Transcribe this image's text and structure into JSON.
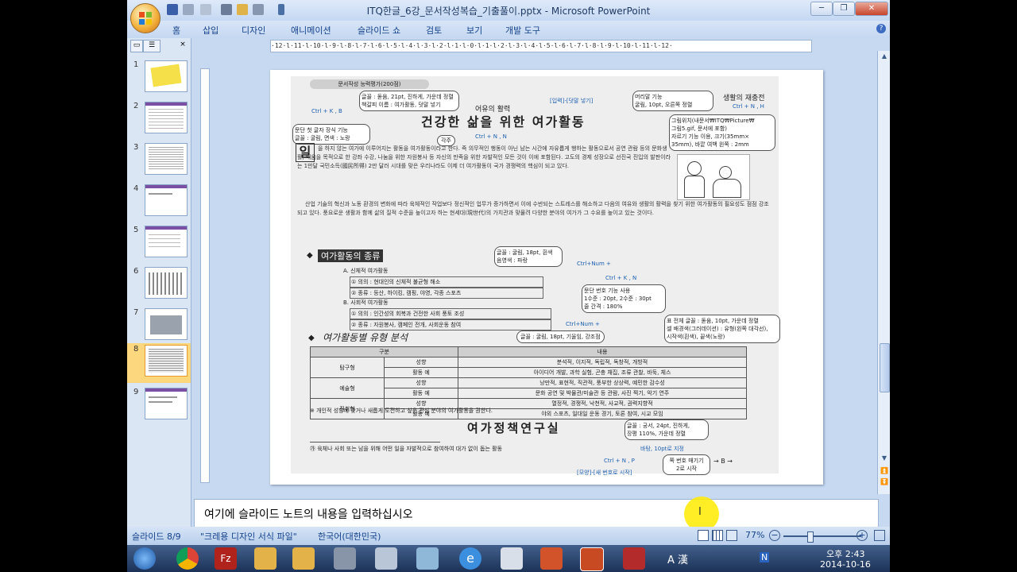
{
  "window": {
    "title": "ITQ한글_6강_문서작성복습_기출풀이.pptx - Microsoft PowerPoint",
    "minimize": "─",
    "restore": "❐",
    "close": "✕"
  },
  "ribbon": {
    "tabs": [
      "홈",
      "삽입",
      "디자인",
      "애니메이션",
      "슬라이드 쇼",
      "검토",
      "보기",
      "개발 도구"
    ],
    "help": "?"
  },
  "ruler": {
    "horizontal": "·12·l·11·l·10·l·9·l·8·l·7·l·6·l·5·l·4·l·3·l·2·l·1·l·0·l·1·l·2·l·3·l·4·l·5·l·6·l·7·l·8·l·9·l·10·l·11·l·12·"
  },
  "thumbnails": {
    "numbers": [
      "1",
      "2",
      "3",
      "4",
      "5",
      "6",
      "7",
      "8",
      "9"
    ],
    "selected_index": 8
  },
  "slide": {
    "doc_section": "문서작성 능력평가(200점)",
    "doc_title": "건강한 삶을 위한 여가활동",
    "title_annotation": "어유의 활력",
    "ctrl_knb": "Ctrl + K , B",
    "ctrl_n_n": "Ctrl + N , N",
    "ctrl_n_h": "Ctrl + N , H",
    "annotation_top_left": "글꼴 : 돋움, 21pt, 진하게, 가운데 정렬\n책갈피 이름 : 여가활동, 덧말 넣기",
    "annotation_top_center": "[입력]-[덧말 넣기]",
    "annotation_top_right": "머리말 기능\n굴림, 10pt, 오른쪽 정렬",
    "annotation_header": "생활의 재충전",
    "annotation_dropcap": "문단 첫 글자 장식 기능\n글꼴 : 굴림, 면색 : 노랑",
    "annotation_footnote": "각주",
    "annotation_image": "그림위치(내문서₩ITQ₩Picture₩\n그림5.gif, 문서에 포함)\n자르기 기능 이용, 크기(35mm×\n35mm), 바깥 여백 왼쪽 : 2mm",
    "dropcap": "일",
    "body_p1": "을 하지 않는 여가에 이루어지는 활동을 여가활동이라고 한다. 즉 의무적인 행동이 아닌 남는 시간에 자유롭게 행하는 활동으로서 공연 관람 등의 문화생활, 배움을 목적으로 한 강좌 수강, 나눔을 위한 자원봉사 등 자신의 만족을 위한 자발적인 모든 것이 이에 포함된다. 고도의 경제 성장으로 선진국 진입의 발판이라는 1만달 국민소득(國民所得) 2만 달러 시대를 맞은 우리나라도 이제 더 여가활동이 국가 경쟁력의 핵심이 되고 있다.",
    "body_p2": "산업 기술의 혁신과 노동 환경의 변화에 따라 육체적인 작업보다 정신적인 업무가 증가하면서 이에 수반되는 스트레스를 해소하고 다음의 여유와 생활의 활력을 찾기 위한 여가활동의 필요성도 점점 강조되고 있다. 풍요로운 생활과 함께 삶의 질적 수준을 높이고자 하는 현세대(現世代)의 가치관과 맞물려 다양한 분야의 여가가 그 수요를 높이고 있는 것이다.",
    "section1": "여가활동의 종류",
    "section1_annotation": "글꼴 : 굴림, 18pt, 흰색\n음영색 : 파랑",
    "ctrl_num_1": "Ctrl+Num +",
    "ctrl_knb2": "Ctrl + K , N",
    "list_annotation": "문단 번호 기능 사용\n1수준 : 20pt, 2수준 : 30pt\n줄 간격 : 180%",
    "list": [
      "A. 신체적 여가활동",
      "① 의의 : 현대인의 신체적 불균형 해소",
      "② 종류 : 등산, 하이킹, 캠핑, 야영, 각종 스포츠",
      "B. 사회적 여가활동",
      "① 의의 : 인간성의 회복과 건전한 사회 풍토 조성",
      "② 종류 : 자원봉사, 캠페인 전개, 사회운동 참여"
    ],
    "ctrl_num_2": "Ctrl+Num +",
    "table_annotation_top": "표 전체 글꼴 : 돋움, 10pt, 가운데 정렬\n셀 배경색(그러데이션) : 유형(왼쪽 대각선),\n시작색(흰색), 끝색(노랑)",
    "section2": "여가활동별 유형 분석",
    "section2_annotation": "글꼴 : 굴림, 18pt, 기울임, 강조점",
    "table_headers": [
      "구분",
      "내용"
    ],
    "table_rows": [
      [
        "탐구형",
        "성향",
        "분석적, 이지적, 독립적, 독창적, 개방적"
      ],
      [
        "",
        "활동 예",
        "아이디어 개발, 과학 실험, 곤충 채집, 조류 관찰, 바둑, 체스"
      ],
      [
        "예술형",
        "성향",
        "낭만적, 표현적, 직관적, 풍부한 상상력, 예민한 감수성"
      ],
      [
        "",
        "활동 예",
        "문화 공연 및 박물관/미술관 등 관람, 사진 찍기, 악기 연주"
      ],
      [
        "진취형",
        "성향",
        "열정적, 경쟁적, 낙천적, 사교적, 권력지향적"
      ],
      [
        "",
        "활동 예",
        "야외 스포츠, 일대일 운동 경기, 토론 참여, 시교 모임"
      ]
    ],
    "table_note": "※ 개인적 성향에 맞거나 새롭게 도전하고 싶은 관심 분야의 여가활동을 권한다.",
    "footer_title": "여가정책연구실",
    "footer_annotation": "글꼴 : 궁서, 24pt, 진하게,\n장평 110%, 가운데 정렬",
    "footnote": "㉮ 육체나 사회 또는 남을 위해 어떤 일을 자발적으로 참여하여 대가 없이 돕는 활동",
    "footnote_annotation": "바탕, 10pt로 지정",
    "ctrl_np": "Ctrl + N , P",
    "page_annotation": "쪽 번호 매기기\n2로 시작",
    "page_marker": "→ B →",
    "page_menu": "[모양]-[새 번호로 시작]"
  },
  "notes": {
    "placeholder": "여기에 슬라이드 노트의 내용을 입력하십시오",
    "cursor": "I"
  },
  "statusbar": {
    "slide": "슬라이드 8/9",
    "theme": "\"크레용 디자인 서식 파일\"",
    "language": "한국어(대한민국)",
    "zoom": "77%"
  },
  "taskbar": {
    "ime": "A 漢",
    "ime_mode": "N",
    "time": "오후 2:43",
    "date": "2014-10-16"
  }
}
